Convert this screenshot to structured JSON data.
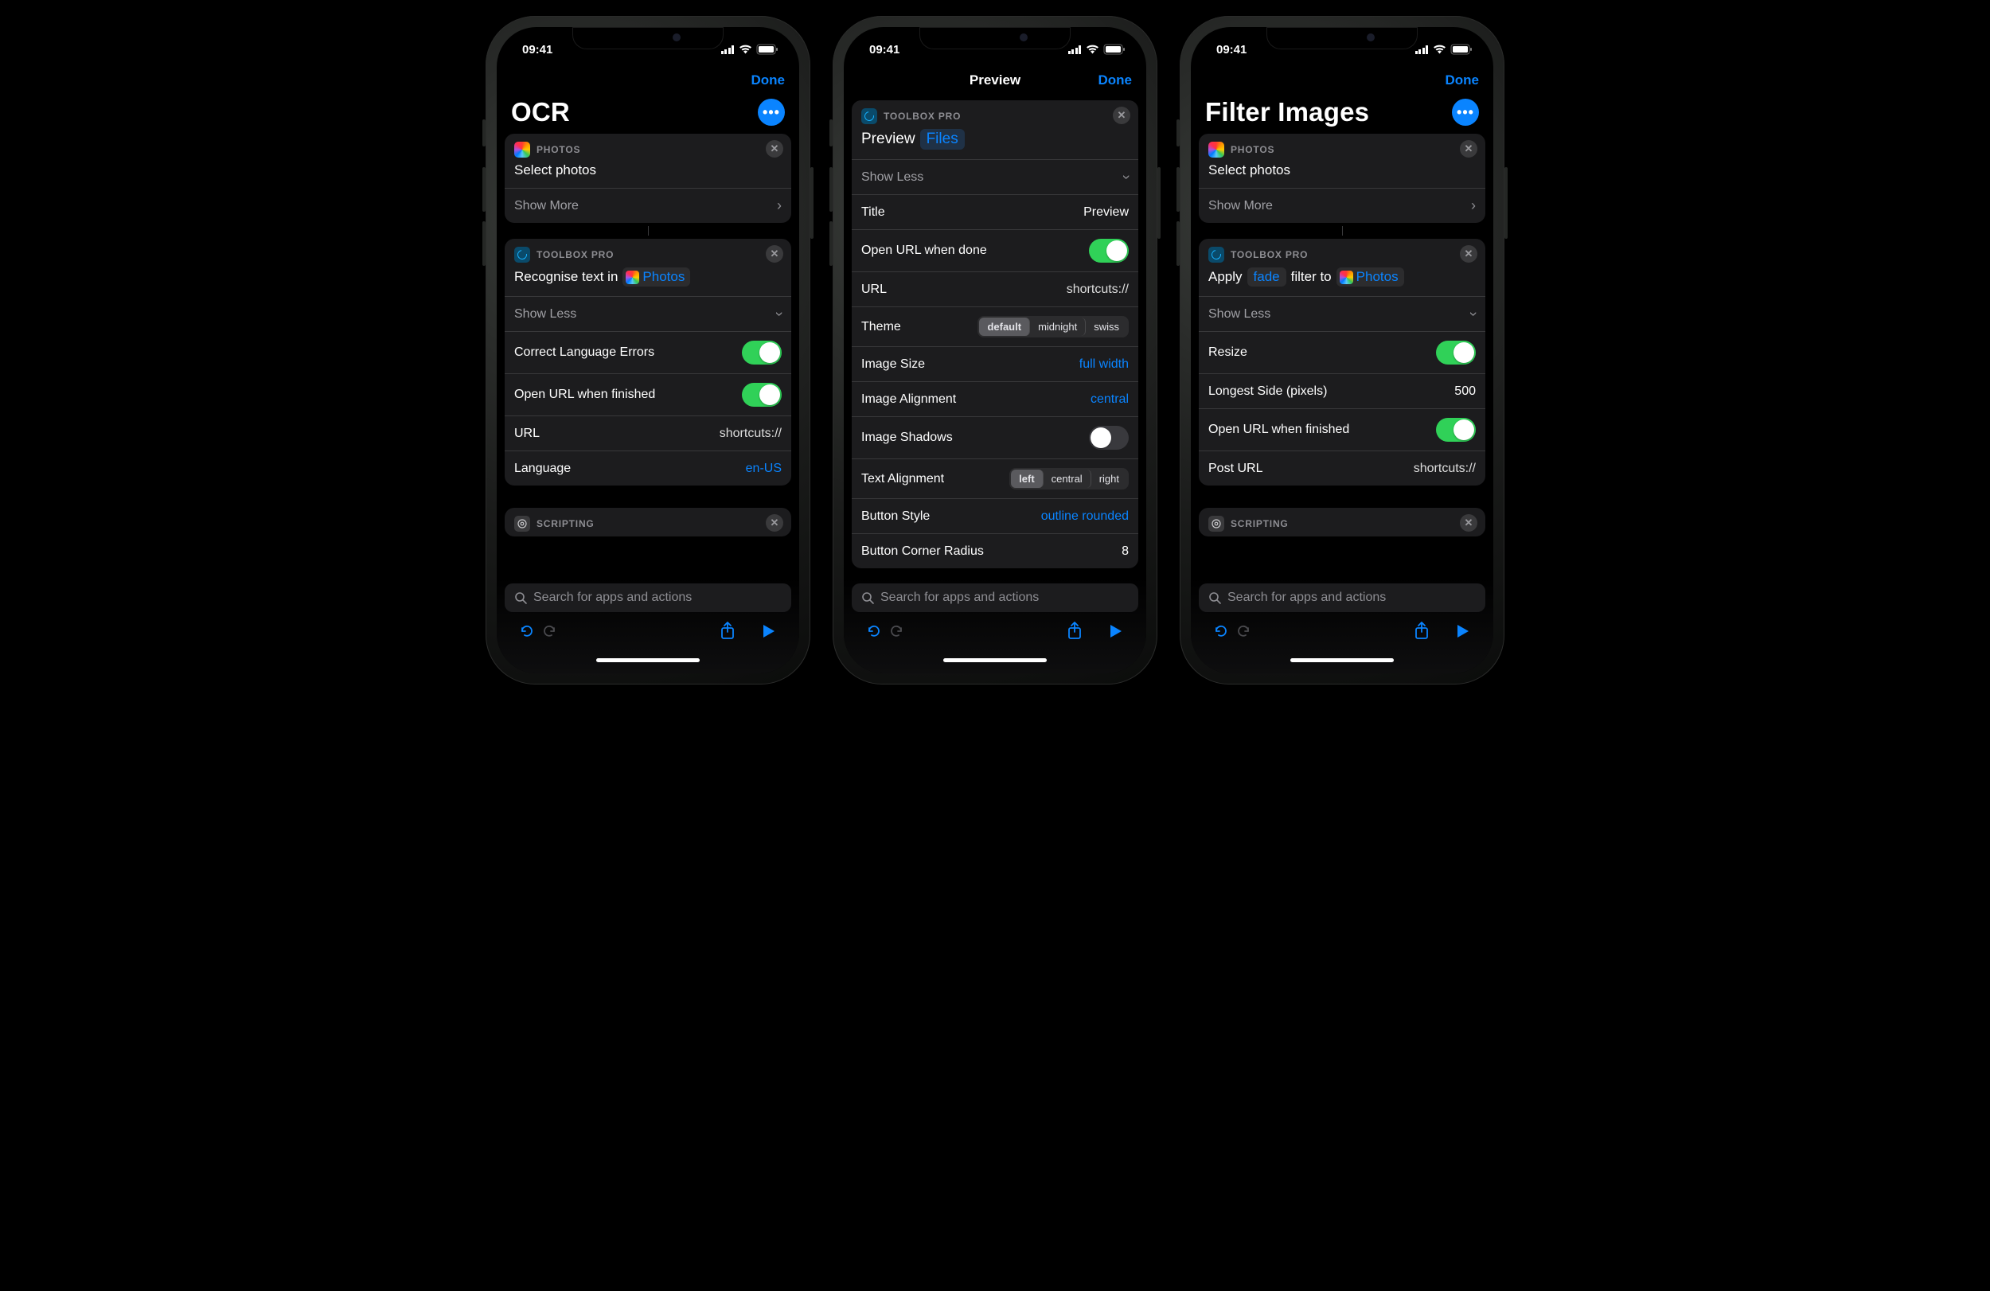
{
  "status": {
    "time": "09:41"
  },
  "nav": {
    "done": "Done",
    "preview_title": "Preview"
  },
  "search": {
    "placeholder": "Search for apps and actions"
  },
  "apps": {
    "photos": "PHOTOS",
    "toolbox": "TOOLBOX PRO",
    "scripting": "SCRIPTING"
  },
  "common": {
    "select_photos": "Select photos",
    "show_more": "Show More",
    "show_less": "Show Less",
    "photos_token": "Photos"
  },
  "phone1": {
    "title": "OCR",
    "recognise_prefix": "Recognise text in",
    "rows": {
      "correct": "Correct Language Errors",
      "open_url_finished": "Open URL when finished",
      "url_label": "URL",
      "url_value": "shortcuts://",
      "lang_label": "Language",
      "lang_value": "en-US"
    }
  },
  "phone2": {
    "preview_prefix": "Preview",
    "files_token": "Files",
    "rows": {
      "title_label": "Title",
      "title_value": "Preview",
      "open_url_done": "Open URL when done",
      "url_label": "URL",
      "url_value": "shortcuts://",
      "theme": "Theme",
      "theme_opts": [
        "default",
        "midnight",
        "swiss"
      ],
      "image_size_label": "Image Size",
      "image_size_value": "full width",
      "image_align_label": "Image Alignment",
      "image_align_value": "central",
      "image_shadows": "Image Shadows",
      "text_align": "Text Alignment",
      "text_align_opts": [
        "left",
        "central",
        "right"
      ],
      "button_style_label": "Button Style",
      "button_style_value": "outline rounded",
      "button_radius_label": "Button Corner Radius",
      "button_radius_value": "8"
    }
  },
  "phone3": {
    "title": "Filter Images",
    "apply_prefix": "Apply",
    "fade_token": "fade",
    "apply_mid": "filter to",
    "rows": {
      "resize": "Resize",
      "longest_label": "Longest Side (pixels)",
      "longest_value": "500",
      "open_url_finished": "Open URL when finished",
      "post_url_label": "Post URL",
      "post_url_value": "shortcuts://"
    }
  }
}
